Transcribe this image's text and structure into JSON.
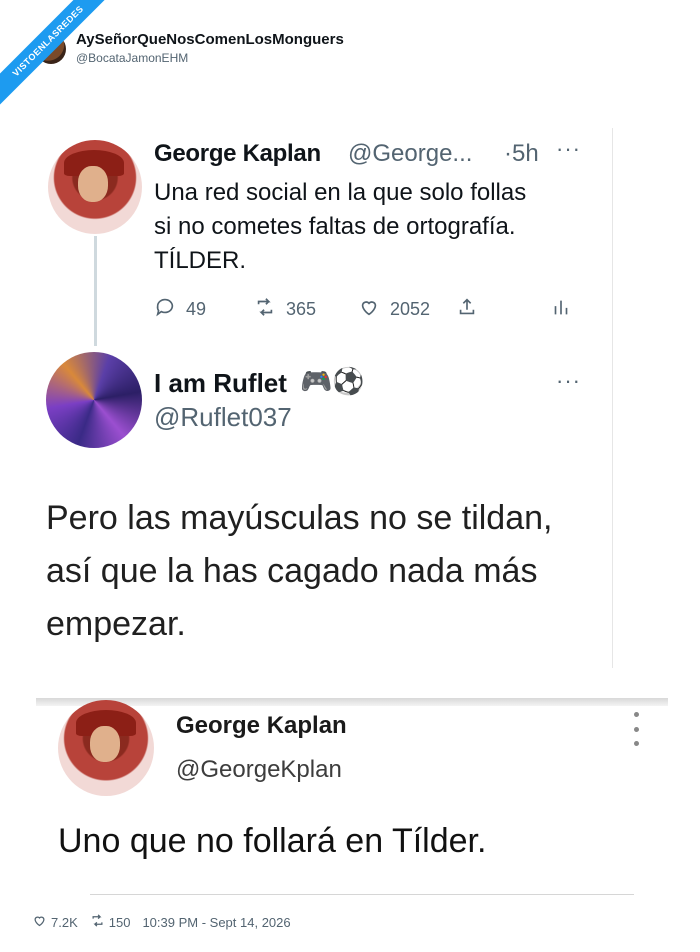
{
  "ribbon": {
    "text": "VISTOENLASREDES"
  },
  "header": {
    "name": "AySeñorQueNosComenLosMonguers",
    "handle": "@BocataJamonEHM"
  },
  "tweet1": {
    "name": "George Kaplan",
    "handle": "@George...",
    "time": "·5h",
    "more": "···",
    "text": "Una red social en la que solo follas\nsi no cometes faltas de ortografía.\nTÍLDER.",
    "replies": "49",
    "retweets": "365",
    "likes": "2052"
  },
  "tweet2": {
    "name": "I am Ruflet",
    "emoji": "🎮⚽",
    "handle": "@Ruflet037",
    "more": "···",
    "text": "Pero las mayúsculas no se tildan,\nasí que la has cagado nada más\nempezar."
  },
  "tweet3": {
    "name": "George Kaplan",
    "handle": "@GeorgeKplan",
    "text": "Uno que no follará en Tílder."
  },
  "footer": {
    "likes": "7.2K",
    "retweets": "150",
    "timestamp": "10:39 PM - Sept 14, 2026"
  },
  "colors": {
    "accent": "#1d9bf0",
    "muted": "#536471",
    "text": "#0f1419"
  },
  "icons": [
    "reply-icon",
    "retweet-icon",
    "like-icon",
    "share-icon",
    "analytics-icon",
    "more-icon"
  ]
}
